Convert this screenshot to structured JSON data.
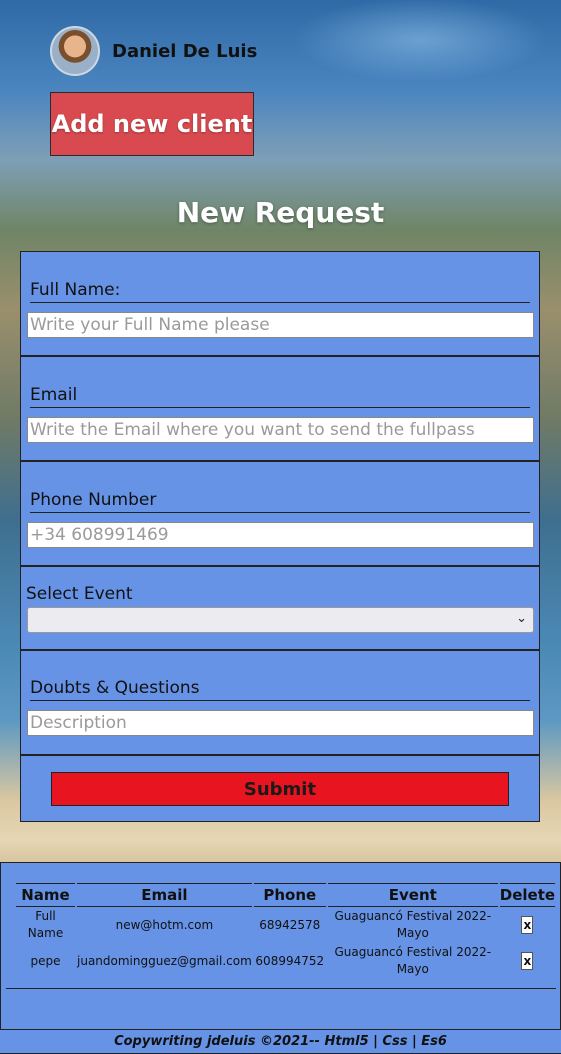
{
  "user": {
    "name": "Daniel De Luis"
  },
  "add_client": {
    "label": "Add new client"
  },
  "form": {
    "title": "New Request",
    "fullname": {
      "label": "Full Name:",
      "placeholder": "Write your Full Name please"
    },
    "email": {
      "label": "Email",
      "placeholder": "Write the Email where you want to send the fullpass"
    },
    "phone": {
      "label": "Phone Number",
      "placeholder": "+34 608991469"
    },
    "event": {
      "label": "Select Event",
      "value": ""
    },
    "doubts": {
      "label": "Doubts & Questions",
      "placeholder": "Description"
    },
    "submit": "Submit"
  },
  "table": {
    "headers": [
      "Name",
      "Email",
      "Phone",
      "Event",
      "Delete"
    ],
    "rows": [
      {
        "name": "Full Name",
        "email": "new@hotm.com",
        "phone": "68942578",
        "event": "Guaguancó Festival 2022-Mayo",
        "delete": "x"
      },
      {
        "name": "pepe",
        "email": "juandomingguez@gmail.com",
        "phone": "608994752",
        "event": "Guaguancó Festival 2022-Mayo",
        "delete": "x"
      }
    ]
  },
  "footer": {
    "text": "Copywriting jdeluis ©2021-- Html5 | Css | Es6"
  }
}
